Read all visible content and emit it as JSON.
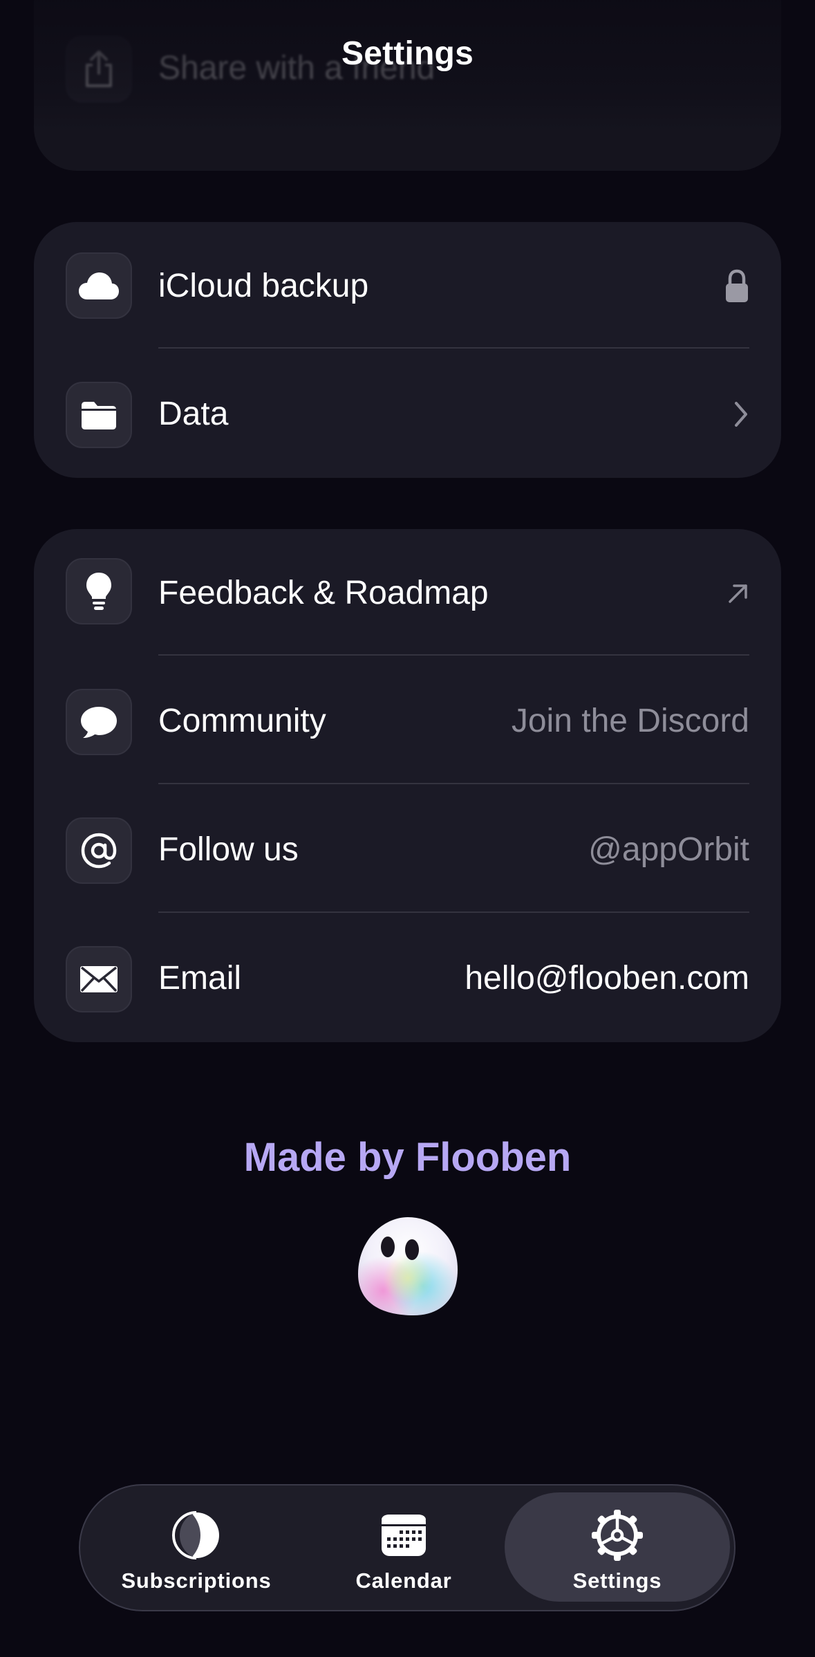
{
  "header": {
    "title": "Settings"
  },
  "top_group": {
    "share_label": "Share with a friend",
    "share_icon": "share-icon"
  },
  "data_group": {
    "items": [
      {
        "label": "iCloud backup",
        "icon": "cloud-icon",
        "accessory": "lock-icon"
      },
      {
        "label": "Data",
        "icon": "folder-icon",
        "accessory": "chevron-right-icon"
      }
    ]
  },
  "social_group": {
    "items": [
      {
        "label": "Feedback & Roadmap",
        "icon": "lightbulb-icon",
        "accessory": "external-link-arrow-icon",
        "value": ""
      },
      {
        "label": "Community",
        "icon": "chat-bubble-icon",
        "value": "Join the Discord"
      },
      {
        "label": "Follow us",
        "icon": "at-icon",
        "value": "@appOrbit"
      },
      {
        "label": "Email",
        "icon": "envelope-icon",
        "value": "hello@flooben.com"
      }
    ]
  },
  "footer": {
    "made_by": "Made by Flooben",
    "mascot": "ghost-mascot"
  },
  "tabbar": {
    "tabs": [
      {
        "label": "Subscriptions",
        "icon": "moon-phase-icon",
        "active": false
      },
      {
        "label": "Calendar",
        "icon": "calendar-icon",
        "active": false
      },
      {
        "label": "Settings",
        "icon": "gear-icon",
        "active": true
      }
    ]
  },
  "colors": {
    "background": "#0a0812",
    "card": "#1b1a26",
    "accent": "#b7a8f4",
    "secondary_text": "#8e8d99"
  }
}
